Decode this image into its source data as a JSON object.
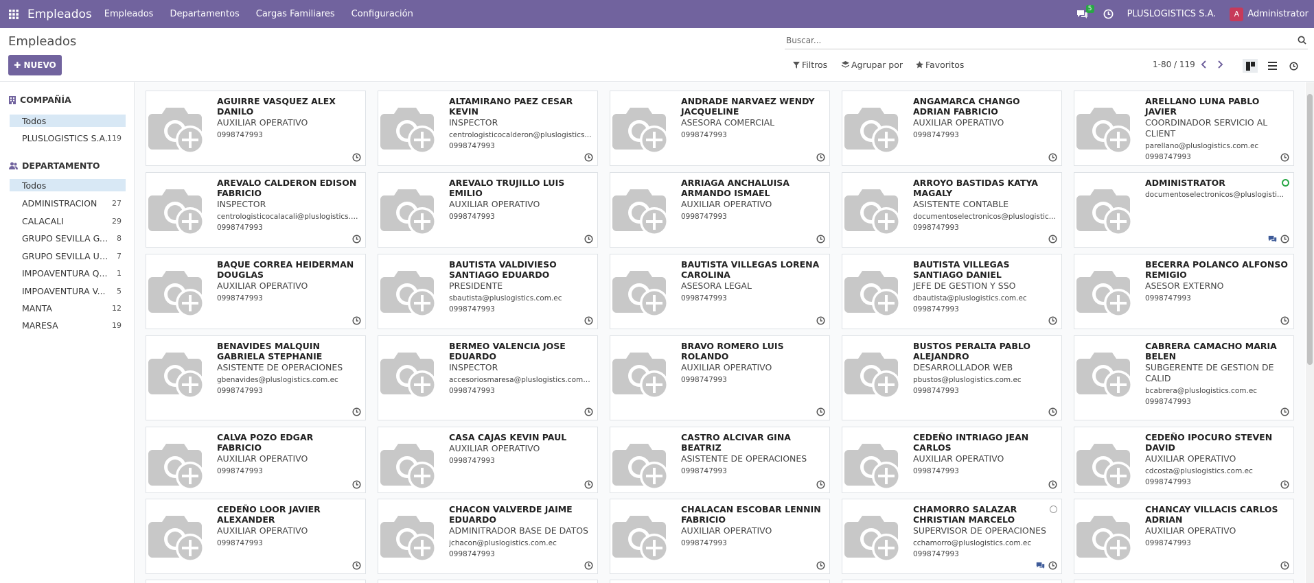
{
  "nav": {
    "brand": "Empleados",
    "menus": [
      "Empleados",
      "Departamentos",
      "Cargas Familiares",
      "Configuración"
    ],
    "chat_badge": "5",
    "company": "PLUSLOGISTICS S.A.",
    "avatar_letter": "A",
    "user": "Administrator"
  },
  "control": {
    "breadcrumb": "Empleados",
    "new_label": "NUEVO",
    "search_placeholder": "Buscar...",
    "filters": "Filtros",
    "group_by": "Agrupar por",
    "favorites": "Favoritos",
    "pager": "1-80 / 119"
  },
  "sidebar": {
    "company_title": "COMPAÑÍA",
    "company_items": [
      {
        "label": "Todos",
        "count": ""
      },
      {
        "label": "PLUSLOGISTICS S.A.",
        "count": "119"
      }
    ],
    "dept_title": "DEPARTAMENTO",
    "dept_items": [
      {
        "label": "Todos",
        "count": ""
      },
      {
        "label": "ADMINISTRACION",
        "count": "27"
      },
      {
        "label": "CALACALI",
        "count": "29"
      },
      {
        "label": "GRUPO SEVILLA GYE",
        "count": "8"
      },
      {
        "label": "GRUPO SEVILLA UIO",
        "count": "7"
      },
      {
        "label": "IMPOAVENTURA Q...",
        "count": "1"
      },
      {
        "label": "IMPOAVENTURA V...",
        "count": "5"
      },
      {
        "label": "MANTA",
        "count": "12"
      },
      {
        "label": "MARESA",
        "count": "19"
      }
    ]
  },
  "employees": [
    {
      "name": "AGUIRRE VASQUEZ ALEX DANILO",
      "job": "AUXILIAR OPERATIVO",
      "email": "",
      "phone": "0998747993"
    },
    {
      "name": "ALTAMIRANO PAEZ CESAR KEVIN",
      "job": "INSPECTOR",
      "email": "centrologisticocalderon@pluslogistics...",
      "phone": "0998747993"
    },
    {
      "name": "ANDRADE NARVAEZ WENDY JACQUELINE",
      "job": "ASESORA COMERCIAL",
      "email": "",
      "phone": "0998747993"
    },
    {
      "name": "ANGAMARCA CHANGO ADRIAN FABRICIO",
      "job": "AUXILIAR OPERATIVO",
      "email": "",
      "phone": "0998747993"
    },
    {
      "name": "ARELLANO LUNA PABLO JAVIER",
      "job": "COORDINADOR SERVICIO AL CLIENT",
      "email": "parellano@pluslogistics.com.ec",
      "phone": "0998747993"
    },
    {
      "name": "AREVALO CALDERON EDISON FABRICIO",
      "job": "INSPECTOR",
      "email": "centrologisticocalacali@pluslogistics.c...",
      "phone": "0998747993"
    },
    {
      "name": "AREVALO TRUJILLO LUIS EMILIO",
      "job": "AUXILIAR OPERATIVO",
      "email": "",
      "phone": "0998747993"
    },
    {
      "name": "ARRIAGA ANCHALUISA ARMANDO ISMAEL",
      "job": "AUXILIAR OPERATIVO",
      "email": "",
      "phone": "0998747993"
    },
    {
      "name": "ARROYO BASTIDAS KATYA MAGALY",
      "job": "ASISTENTE CONTABLE",
      "email": "documentoselectronicos@pluslogistic...",
      "phone": "0998747993"
    },
    {
      "name": "Administrator",
      "job": "",
      "email": "documentoselectronicos@pluslogisti...",
      "phone": ""
    },
    {
      "name": "BAQUE CORREA HEIDERMAN DOUGLAS",
      "job": "AUXILIAR OPERATIVO",
      "email": "",
      "phone": "0998747993"
    },
    {
      "name": "BAUTISTA VALDIVIESO SANTIAGO EDUARDO",
      "job": "PRESIDENTE",
      "email": "sbautista@pluslogistics.com.ec",
      "phone": "0998747993"
    },
    {
      "name": "BAUTISTA VILLEGAS LORENA CAROLINA",
      "job": "ASESORA LEGAL",
      "email": "",
      "phone": "0998747993"
    },
    {
      "name": "BAUTISTA VILLEGAS SANTIAGO DANIEL",
      "job": "JEFE DE GESTION Y SSO",
      "email": "dbautista@pluslogistics.com.ec",
      "phone": "0998747993"
    },
    {
      "name": "BECERRA POLANCO ALFONSO REMIGIO",
      "job": "ASESOR EXTERNO",
      "email": "",
      "phone": "0998747993"
    },
    {
      "name": "BENAVIDES MALQUIN GABRIELA STEPHANIE",
      "job": "ASISTENTE DE OPERACIONES",
      "email": "gbenavides@pluslogistics.com.ec",
      "phone": "0998747993"
    },
    {
      "name": "BERMEO VALENCIA JOSE EDUARDO",
      "job": "INSPECTOR",
      "email": "accesoriosmaresa@pluslogistics.com.ec",
      "phone": "0998747993"
    },
    {
      "name": "BRAVO ROMERO LUIS ROLANDO",
      "job": "AUXILIAR OPERATIVO",
      "email": "",
      "phone": "0998747993"
    },
    {
      "name": "BUSTOS PERALTA PABLO ALEJANDRO",
      "job": "DESARROLLADOR WEB",
      "email": "pbustos@pluslogistics.com.ec",
      "phone": "0998747993"
    },
    {
      "name": "CABRERA CAMACHO MARIA BELEN",
      "job": "SUBGERENTE DE GESTION DE CALID",
      "email": "bcabrera@pluslogistics.com.ec",
      "phone": "0998747993"
    },
    {
      "name": "CALVA POZO EDGAR FABRICIO",
      "job": "AUXILIAR OPERATIVO",
      "email": "",
      "phone": "0998747993"
    },
    {
      "name": "CASA CAJAS KEVIN PAUL",
      "job": "AUXILIAR OPERATIVO",
      "email": "",
      "phone": "0998747993"
    },
    {
      "name": "CASTRO ALCIVAR GINA BEATRIZ",
      "job": "ASISTENTE DE OPERACIONES",
      "email": "",
      "phone": "0998747993"
    },
    {
      "name": "CEDEÑO INTRIAGO JEAN CARLOS",
      "job": "AUXILIAR OPERATIVO",
      "email": "",
      "phone": "0998747993"
    },
    {
      "name": "CEDEÑO IPOCURO STEVEN DAVID",
      "job": "AUXILIAR OPERATIVO",
      "email": "cdcosta@pluslogistics.com.ec",
      "phone": "0998747993"
    },
    {
      "name": "CEDEÑO LOOR JAVIER ALEXANDER",
      "job": "AUXILIAR OPERATIVO",
      "email": "",
      "phone": "0998747993"
    },
    {
      "name": "CHACON VALVERDE JAIME EDUARDO",
      "job": "ADMINITRADOR BASE DE DATOS",
      "email": "jchacon@pluslogistics.com.ec",
      "phone": "0998747993"
    },
    {
      "name": "CHALACAN ESCOBAR LENNIN FABRICIO",
      "job": "AUXILIAR OPERATIVO",
      "email": "",
      "phone": "0998747993"
    },
    {
      "name": "CHAMORRO SALAZAR CHRISTIAN MARCELO",
      "job": "SUPERVISOR DE OPERACIONES",
      "email": "cchamorro@pluslogistics.com.ec",
      "phone": "0998747993"
    },
    {
      "name": "CHANCAY VILLACIS CARLOS ADRIAN",
      "job": "AUXILIAR OPERATIVO",
      "email": "",
      "phone": "0998747993"
    }
  ]
}
